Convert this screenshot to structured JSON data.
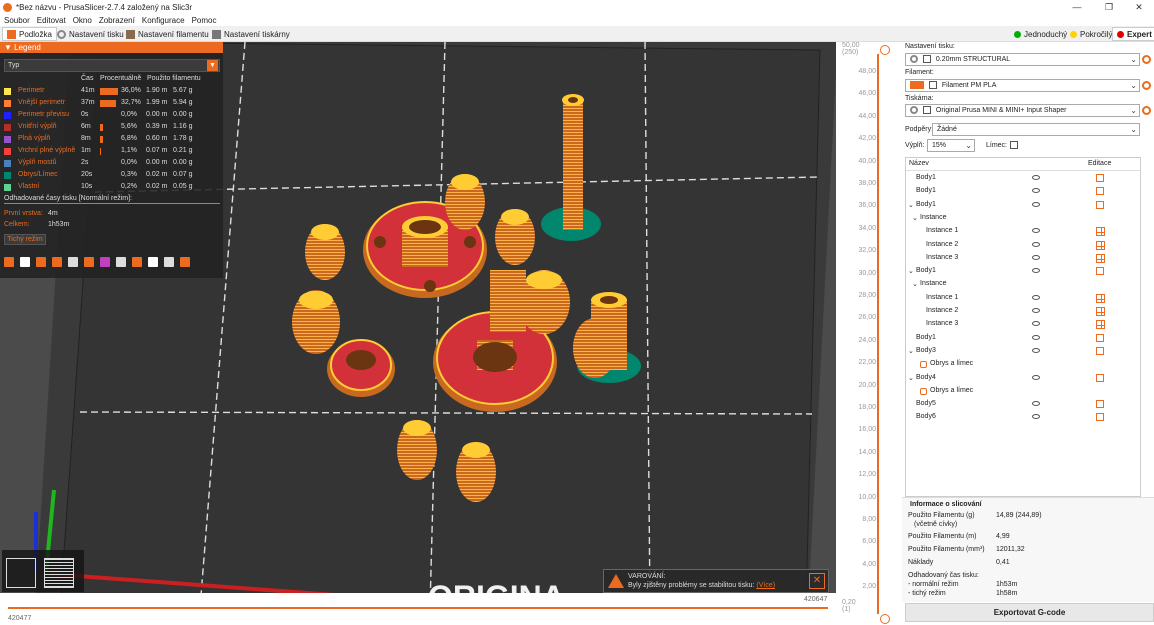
{
  "window": {
    "title": "*Bez názvu - PrusaSlicer-2.7.4 založený na Slic3r"
  },
  "menu": [
    "Soubor",
    "Editovat",
    "Okno",
    "Zobrazení",
    "Konfigurace",
    "Pomoc"
  ],
  "tabs": [
    "Podložka",
    "Nastavení tisku",
    "Nastavení filamentu",
    "Nastavení tiskárny"
  ],
  "modes": [
    {
      "label": "Jednoduchý",
      "color": "#00b000"
    },
    {
      "label": "Pokročilý",
      "color": "#ffd200"
    },
    {
      "label": "Expert",
      "color": "#e00000"
    }
  ],
  "legend": {
    "header": "Legend",
    "type_select": "Typ",
    "col_time": "Čas",
    "col_percent": "Procentuálně",
    "col_used": "Použito filamentu",
    "rows": [
      {
        "name": "Perimetr",
        "color": "#ffe64d",
        "time": "41m",
        "pct": 36.0,
        "pct_label": "36,0%",
        "m": "1.90 m",
        "g": "5.67 g"
      },
      {
        "name": "Vnější perimetr",
        "color": "#ff7d38",
        "time": "37m",
        "pct": 32.7,
        "pct_label": "32,7%",
        "m": "1.99 m",
        "g": "5.94 g"
      },
      {
        "name": "Perimetr převisu",
        "color": "#1f1fff",
        "time": "0s",
        "pct": 0.0,
        "pct_label": "0,0%",
        "m": "0.00 m",
        "g": "0.00 g"
      },
      {
        "name": "Vnitřní výplň",
        "color": "#b03029",
        "time": "6m",
        "pct": 5.6,
        "pct_label": "5,6%",
        "m": "0.39 m",
        "g": "1.16 g"
      },
      {
        "name": "Plná výplň",
        "color": "#9654cc",
        "time": "8m",
        "pct": 6.8,
        "pct_label": "6,8%",
        "m": "0.60 m",
        "g": "1.78 g"
      },
      {
        "name": "Vrchní plné výplně",
        "color": "#f04040",
        "time": "1m",
        "pct": 1.1,
        "pct_label": "1,1%",
        "m": "0.07 m",
        "g": "0.21 g"
      },
      {
        "name": "Výplň mostů",
        "color": "#4d80ba",
        "time": "2s",
        "pct": 0.0,
        "pct_label": "0,0%",
        "m": "0.00 m",
        "g": "0.00 g"
      },
      {
        "name": "Obrys/Límec",
        "color": "#00876e",
        "time": "20s",
        "pct": 0.3,
        "pct_label": "0,3%",
        "m": "0.02 m",
        "g": "0.07 g"
      },
      {
        "name": "Vlastní",
        "color": "#5ed194",
        "time": "10s",
        "pct": 0.2,
        "pct_label": "0,2%",
        "m": "0.02 m",
        "g": "0.05 g"
      }
    ],
    "estimate_title": "Odhadované časy tisku [Normální režim]:",
    "first_layer_label": "První vrstva:",
    "first_layer_value": "4m",
    "total_label": "Celkem:",
    "total_value": "1h53m",
    "mode_button": "Tichý režim"
  },
  "viewport": {
    "bed_text": "ORIGINA",
    "warning_title": "VAROVÁNÍ:",
    "warning_msg": "Byly zjištěny problémy se stabilitou tisku:",
    "warning_link": "(Více)"
  },
  "hslider": {
    "left": "420477",
    "right": "420647"
  },
  "vslider": {
    "top": "50,00",
    "top_sub": "(250)",
    "bottom": "0,20",
    "bottom_sub": "(1)",
    "ticks": [
      "48,00",
      "46,00",
      "44,00",
      "42,00",
      "40,00",
      "38,00",
      "36,00",
      "34,00",
      "32,00",
      "30,00",
      "28,00",
      "26,00",
      "24,00",
      "22,00",
      "20,00",
      "18,00",
      "16,00",
      "14,00",
      "12,00",
      "10,00",
      "8,00",
      "6,00",
      "4,00",
      "2,00"
    ]
  },
  "panel": {
    "print_label": "Nastavení tisku:",
    "print_value": "0.20mm STRUCTURAL",
    "filament_label": "Filament:",
    "filament_value": "Filament PM PLA",
    "filament_color": "#ed6b21",
    "printer_label": "Tiskárna:",
    "printer_value": "Original Prusa MINI & MINI+ Input Shaper",
    "supports_label": "Podpěry:",
    "supports_value": "Žádné",
    "infill_label": "Výplň:",
    "infill_value": "15%",
    "brim_label": "Límec:"
  },
  "objects": {
    "col_name": "Název",
    "col_edit": "Editace",
    "items": [
      {
        "label": "Body1",
        "level": 0,
        "exp": "",
        "kind": "obj"
      },
      {
        "label": "Body1",
        "level": 0,
        "exp": "",
        "kind": "obj"
      },
      {
        "label": "Body1",
        "level": 0,
        "exp": "v",
        "kind": "obj"
      },
      {
        "label": "Instance",
        "level": 1,
        "exp": "v",
        "kind": "group"
      },
      {
        "label": "Instance 1",
        "level": 2,
        "exp": "",
        "kind": "inst"
      },
      {
        "label": "Instance 2",
        "level": 2,
        "exp": "",
        "kind": "inst"
      },
      {
        "label": "Instance 3",
        "level": 2,
        "exp": "",
        "kind": "inst"
      },
      {
        "label": "Body1",
        "level": 0,
        "exp": "v",
        "kind": "obj"
      },
      {
        "label": "Instance",
        "level": 1,
        "exp": "v",
        "kind": "group"
      },
      {
        "label": "Instance 1",
        "level": 2,
        "exp": "",
        "kind": "inst"
      },
      {
        "label": "Instance 2",
        "level": 2,
        "exp": "",
        "kind": "inst"
      },
      {
        "label": "Instance 3",
        "level": 2,
        "exp": "",
        "kind": "inst"
      },
      {
        "label": "Body1",
        "level": 0,
        "exp": "",
        "kind": "obj"
      },
      {
        "label": "Body3",
        "level": 0,
        "exp": "v",
        "kind": "obj"
      },
      {
        "label": "Obrys a límec",
        "level": 1,
        "exp": "",
        "kind": "skirt"
      },
      {
        "label": "Body4",
        "level": 0,
        "exp": "v",
        "kind": "obj"
      },
      {
        "label": "Obrys a límec",
        "level": 1,
        "exp": "",
        "kind": "skirt"
      },
      {
        "label": "Body5",
        "level": 0,
        "exp": "",
        "kind": "obj"
      },
      {
        "label": "Body6",
        "level": 0,
        "exp": "",
        "kind": "obj"
      }
    ]
  },
  "info": {
    "title": "Informace o slicování",
    "rows": [
      {
        "k": "Použito Filamentu (g)",
        "k2": "(včetně cívky)",
        "v": "14,89 (244,89)"
      },
      {
        "k": "Použito Filamentu (m)",
        "v": "4,99"
      },
      {
        "k": "Použito Filamentu (mm³)",
        "v": "12011,32"
      },
      {
        "k": "Náklady",
        "v": "0,41"
      },
      {
        "k": "Odhadovaný čas tisku:",
        "v": ""
      },
      {
        "k": " - normální režim",
        "v": "1h53m"
      },
      {
        "k": " - tichý režim",
        "v": "1h58m"
      }
    ]
  },
  "export_button": "Exportovat G-code"
}
